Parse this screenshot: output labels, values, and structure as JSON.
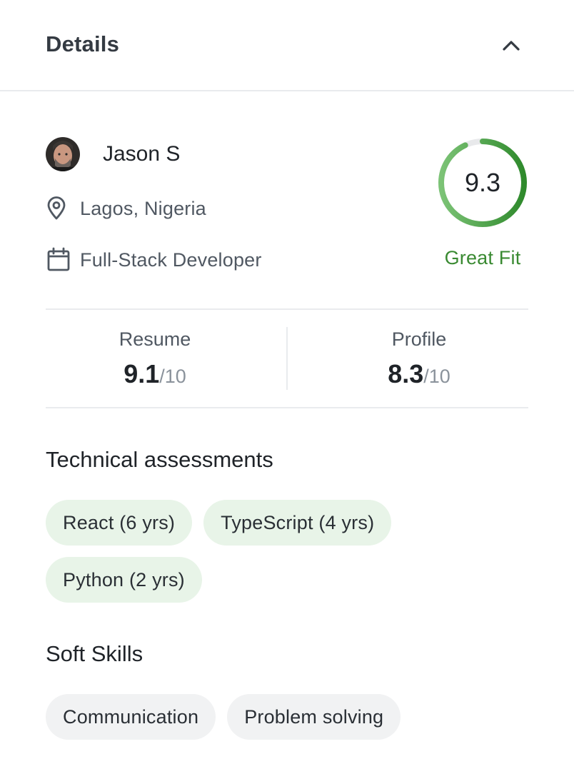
{
  "header": {
    "title": "Details",
    "collapse_icon": "chevron-up-icon"
  },
  "candidate": {
    "name": "Jason S",
    "location": "Lagos, Nigeria",
    "role": "Full-Stack Developer"
  },
  "score": {
    "value": "9.3",
    "fraction": 0.93,
    "label": "Great Fit",
    "ring_color": "#3a8a32",
    "track_color": "#e8e9eb"
  },
  "stats": {
    "resume": {
      "label": "Resume",
      "value": "9.1",
      "outof": "/10"
    },
    "profile": {
      "label": "Profile",
      "value": "8.3",
      "outof": "/10"
    }
  },
  "technical": {
    "title": "Technical assessments",
    "chips": [
      "React (6 yrs)",
      "TypeScript (4 yrs)",
      "Python (2 yrs)"
    ]
  },
  "soft": {
    "title": "Soft Skills",
    "chips": [
      "Communication",
      "Problem solving"
    ]
  },
  "colors": {
    "accent_green": "#3a8a32",
    "chip_green": "#e8f4e8",
    "chip_gray": "#f1f2f3"
  }
}
